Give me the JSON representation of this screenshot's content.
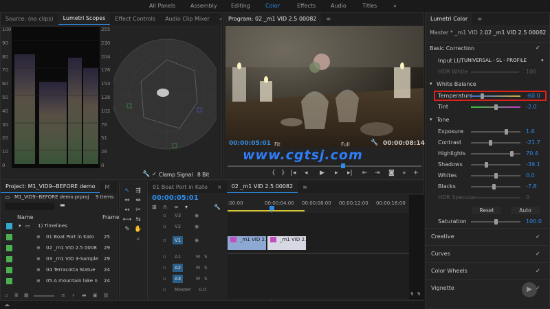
{
  "workspaces": {
    "items": [
      "All Panels",
      "Assembly",
      "Editing",
      "Color",
      "Effects",
      "Audio",
      "Titles"
    ],
    "active": "Color",
    "more": "»"
  },
  "source_panel": {
    "tabs": [
      "Source: (no clips)",
      "Lumetri Scopes",
      "Effect Controls",
      "Audio Clip Mixer"
    ],
    "more": "»",
    "left_axis": [
      "100",
      "90",
      "80",
      "70",
      "60",
      "50",
      "40",
      "30",
      "20",
      "10",
      "0"
    ],
    "right_axis": [
      "255",
      "230",
      "204",
      "178",
      "153",
      "128",
      "102",
      "76",
      "51",
      "26",
      "0"
    ],
    "clamp_label": "Clamp Signal",
    "bit_depth": "8 Bit"
  },
  "program": {
    "title": "Program: 02 _m1 VID 2.5 00082",
    "menu_icon": "≡",
    "timecode": "00:00:05:01",
    "fit": "Fit",
    "quality": "Full",
    "duration": "00:00:08:14",
    "watermark": "www.cgtsj.com"
  },
  "lumetri": {
    "title": "Lumetri Color",
    "menu_icon": "≡",
    "master": "Master * _m1 VID 2....",
    "clip": "02 _m1 VID 2.5 00082",
    "basic_correction": "Basic Correction",
    "input_lut_label": "Input LUT",
    "input_lut_value": "UNIVERSAL - SL - PROFILE",
    "hdr_white_label": "HDR White",
    "hdr_white_value": "100",
    "white_balance": "White Balance",
    "temperature_label": "Temperature",
    "temperature_value": "-60.0",
    "tint_label": "Tint",
    "tint_value": "-2.0",
    "tone": "Tone",
    "tone_rows": [
      {
        "label": "Exposure",
        "value": "1.6",
        "pos": 0.73
      },
      {
        "label": "Contrast",
        "value": "-21.7",
        "pos": 0.39
      },
      {
        "label": "Highlights",
        "value": "70.4",
        "pos": 0.85
      },
      {
        "label": "Shadows",
        "value": "-39.1",
        "pos": 0.3
      },
      {
        "label": "Whites",
        "value": "0.0",
        "pos": 0.5
      },
      {
        "label": "Blacks",
        "value": "-7.8",
        "pos": 0.46
      },
      {
        "label": "HDR Specular",
        "value": "0",
        "pos": 0.0
      }
    ],
    "reset": "Reset",
    "auto": "Auto",
    "saturation_label": "Saturation",
    "saturation_value": "100.0",
    "sections": [
      "Creative",
      "Curves",
      "Color Wheels",
      "Vignette"
    ]
  },
  "project": {
    "title": "Project: M1_VID9--BEFORE demo",
    "tab2": "M",
    "more": "»",
    "file": "M1_VID9--BEFORE demo.prproj",
    "count": "9 Items",
    "col_name": "Name",
    "col_frame": "Frame",
    "folder": "1) Timelines",
    "items": [
      {
        "name": "01 Boat Port in Kato",
        "frame": "25"
      },
      {
        "name": "02 _m1 VID 2.5 0008",
        "frame": "29"
      },
      {
        "name": "03 _m1 VID 3-Sample",
        "frame": "29"
      },
      {
        "name": "04 Terracotta Statue",
        "frame": "24"
      },
      {
        "name": "05 A mountain lake n",
        "frame": "24"
      }
    ]
  },
  "timeline": {
    "tabs": [
      "01 Boat Port in Kato",
      "02 _m1 VID 2.5 00082"
    ],
    "menu_icon": "≡",
    "timecode": "00:00:05:01",
    "ruler": [
      ":00:00",
      "00:00:04:00",
      "00:00:08:00",
      "00:00:12:00",
      "00:00:16:00",
      "00:0"
    ],
    "tracks": [
      "V3",
      "V2",
      "V1",
      "A1",
      "A2",
      "A3",
      "Master"
    ],
    "master_value": "0.0",
    "clip1": "_m1 VID 2.5",
    "clip2": "_m1 VID 2.5",
    "meter_left": "S",
    "meter_right": "S"
  }
}
